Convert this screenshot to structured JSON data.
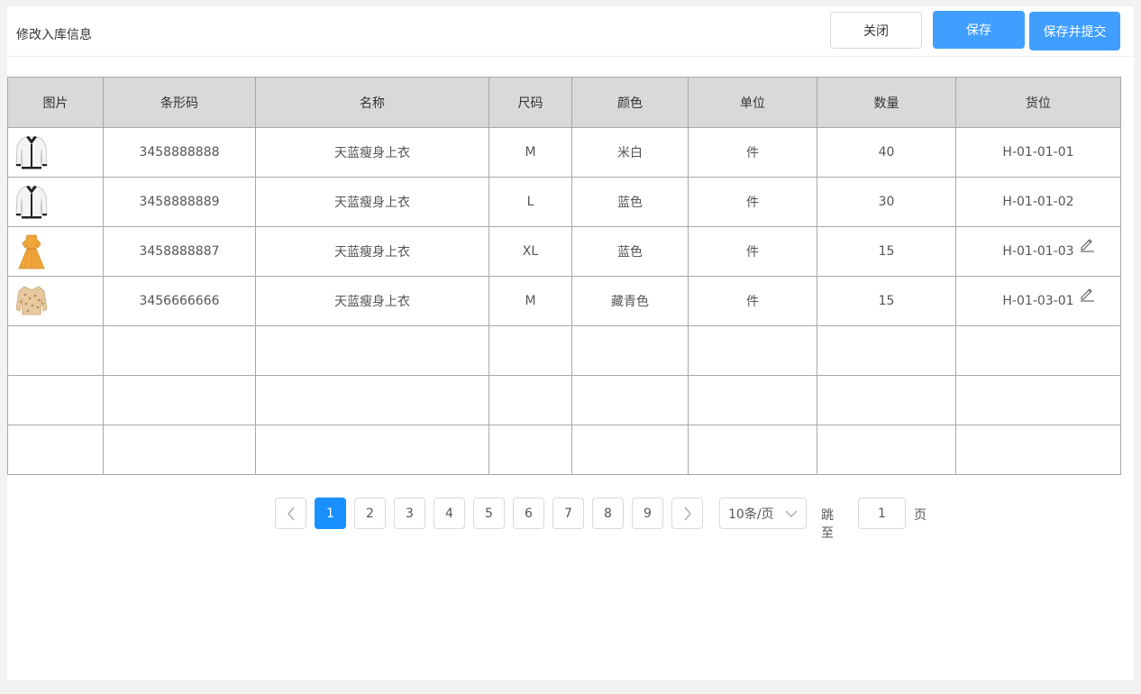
{
  "header": {
    "title": "修改入库信息",
    "close_label": "关闭",
    "save_label": "保存",
    "save_submit_label": "保存并提交"
  },
  "table": {
    "columns": [
      "图片",
      "条形码",
      "名称",
      "尺码",
      "颜色",
      "单位",
      "数量",
      "货位"
    ],
    "rows": [
      {
        "image": "white-cardigan",
        "barcode": "3458888888",
        "name": "天蓝瘦身上衣",
        "size": "M",
        "color": "米白",
        "unit": "件",
        "qty": "40",
        "location": "H-01-01-01",
        "editable": false
      },
      {
        "image": "white-cardigan",
        "barcode": "3458888889",
        "name": "天蓝瘦身上衣",
        "size": "L",
        "color": "蓝色",
        "unit": "件",
        "qty": "30",
        "location": "H-01-01-02",
        "editable": false
      },
      {
        "image": "yellow-dress",
        "barcode": "3458888887",
        "name": "天蓝瘦身上衣",
        "size": "XL",
        "color": "蓝色",
        "unit": "件",
        "qty": "15",
        "location": "H-01-01-03",
        "editable": true
      },
      {
        "image": "beige-knit-top",
        "barcode": "3456666666",
        "name": "天蓝瘦身上衣",
        "size": "M",
        "color": "藏青色",
        "unit": "件",
        "qty": "15",
        "location": "H-01-03-01",
        "editable": true
      }
    ],
    "empty_rows": 3
  },
  "pagination": {
    "pages": [
      "1",
      "2",
      "3",
      "4",
      "5",
      "6",
      "7",
      "8",
      "9"
    ],
    "current": "1",
    "page_size_label": "10条/页",
    "jump_label": "跳至",
    "jump_value": "1",
    "page_suffix": "页"
  },
  "colors": {
    "primary": "#409eff",
    "active_page": "#1890ff",
    "header_bg": "#d9d9d9",
    "border": "#a8a8a8"
  },
  "icons": {
    "prev": "chevron-left-icon",
    "next": "chevron-right-icon",
    "edit": "pencil-icon",
    "dropdown": "chevron-down-icon"
  }
}
